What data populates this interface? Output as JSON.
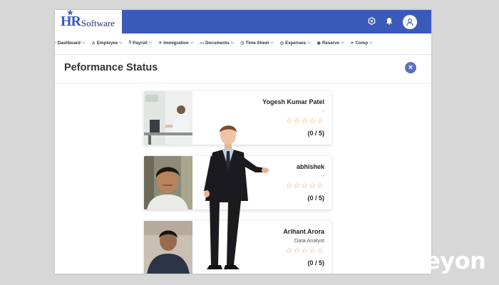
{
  "app": {
    "logo_hr": "HR",
    "logo_text": "Software",
    "icons": [
      "settings-icon",
      "bell-icon",
      "user-avatar-icon"
    ]
  },
  "nav": {
    "items": [
      {
        "label": "Dashboard",
        "icon": "home-icon"
      },
      {
        "label": "Employee",
        "icon": "person-icon"
      },
      {
        "label": "Payroll",
        "icon": "dollar-icon"
      },
      {
        "label": "Immigration",
        "icon": "passport-icon"
      },
      {
        "label": "Documents",
        "icon": "folder-icon"
      },
      {
        "label": "Time Sheet",
        "icon": "clock-icon"
      },
      {
        "label": "Expenses",
        "icon": "coin-icon"
      },
      {
        "label": "Reserve",
        "icon": "pin-icon"
      },
      {
        "label": "Comp",
        "icon": "handshake-icon"
      }
    ]
  },
  "modal": {
    "title": "Peformance Status",
    "close_icon": "close-icon"
  },
  "employees": [
    {
      "name": "Yogesh Kumar Patel",
      "role": "-",
      "rating": 0,
      "max": 5,
      "score": "(0 / 5)"
    },
    {
      "name": "abhishek",
      "role": "-",
      "rating": 0,
      "max": 5,
      "score": "(0 / 5)"
    },
    {
      "name": "Arihant Arora",
      "role": "Data Analyst",
      "rating": 0,
      "max": 5,
      "score": "(0 / 5)"
    }
  ],
  "colors": {
    "topbar": "#3a5ab9",
    "star": "#e8a15e",
    "close": "#5b6dc4"
  },
  "watermark": "kreyon"
}
